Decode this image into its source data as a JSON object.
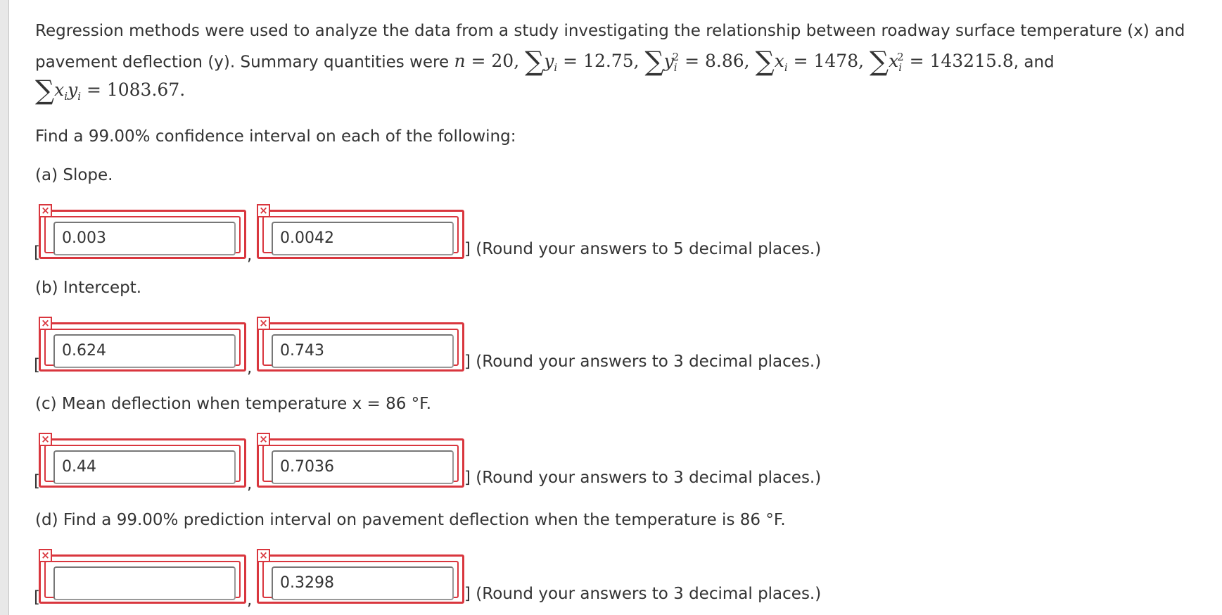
{
  "problem": {
    "line1": "Regression methods were used to analyze the data from a study investigating the relationship between roadway surface temperature (x) and",
    "line2_prefix": "pavement deflection (y). Summary quantities were",
    "n_value": "20",
    "sum_y": "12.75",
    "sum_y2": "8.86",
    "sum_x": "1478",
    "sum_x2": "143215.8",
    "and_word": ", and",
    "sum_xy": "1083.67"
  },
  "instruction": "Find a 99.00% confidence interval on each of the following:",
  "parts": [
    {
      "label": "(a) Slope.",
      "lower": "0.003",
      "upper": "0.0042",
      "note": "] (Round your answers to 5 decimal places.)"
    },
    {
      "label": "(b) Intercept.",
      "lower": "0.624",
      "upper": "0.743",
      "note": "] (Round your answers to 3 decimal places.)"
    },
    {
      "label": "(c) Mean deflection when temperature x = 86 °F.",
      "lower": "0.44",
      "upper": "0.7036",
      "note": "] (Round your answers to 3 decimal places.)"
    },
    {
      "label": "(d) Find a 99.00% prediction interval on pavement deflection when the temperature is 86 °F.",
      "lower": "",
      "upper": "0.3298",
      "note": "] (Round your answers to 3 decimal places.)"
    }
  ],
  "icons": {
    "incorrect": "incorrect-x-icon"
  },
  "colors": {
    "error": "#d9363e"
  }
}
